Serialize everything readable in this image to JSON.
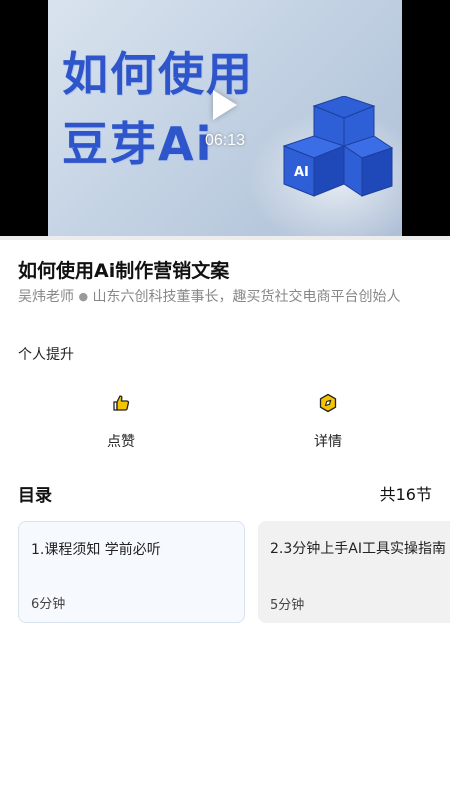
{
  "video": {
    "thumbnail_line1": "如何使用",
    "thumbnail_line2": "豆芽Ai",
    "cube_label": "AI",
    "duration": "06:13"
  },
  "course": {
    "title": "如何使用Ai制作营销文案",
    "teacher": "吴炜老师",
    "teacher_desc": "山东六创科技董事长，趣买货社交电商平台创始人",
    "category": "个人提升"
  },
  "actions": {
    "like_label": "点赞",
    "detail_label": "详情"
  },
  "catalog": {
    "title": "目录",
    "count": "共16节",
    "items": [
      {
        "title": "1.课程须知 学前必听",
        "duration": "6分钟"
      },
      {
        "title": "2.3分钟上手AI工具实操指南",
        "duration": "5分钟"
      }
    ]
  },
  "colors": {
    "thumbnail_text": "#2e55c9",
    "icon_gold": "#d4a000",
    "card_active_bg": "#f6f9fd",
    "card_bg": "#f1f1f1"
  }
}
